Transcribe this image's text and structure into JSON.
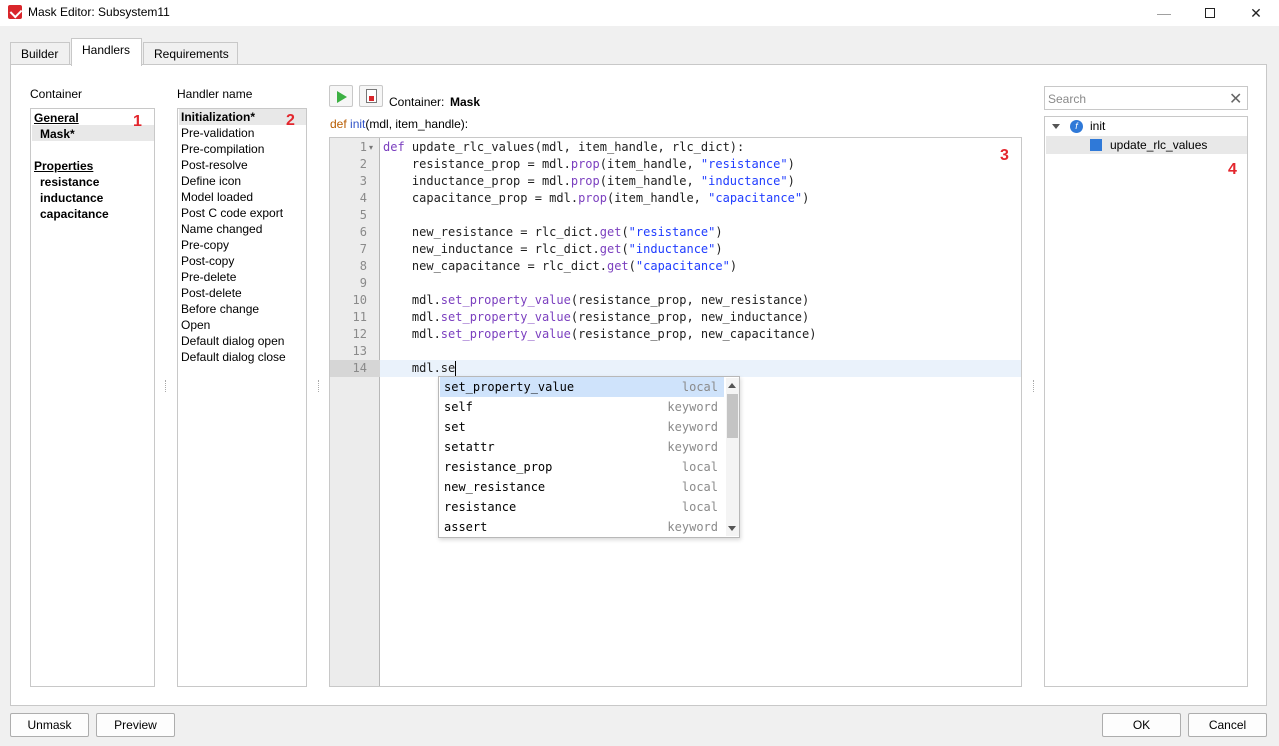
{
  "window": {
    "title": "Mask Editor: Subsystem11"
  },
  "tabs": [
    {
      "label": "Builder",
      "active": false
    },
    {
      "label": "Handlers",
      "active": true
    },
    {
      "label": "Requirements",
      "active": false
    }
  ],
  "container": {
    "label": "Container",
    "general_header": "General",
    "general_items": [
      "Mask*"
    ],
    "properties_header": "Properties",
    "properties_items": [
      "resistance",
      "inductance",
      "capacitance"
    ],
    "marker": "1"
  },
  "handlers": {
    "label": "Handler name",
    "items": [
      "Initialization*",
      "Pre-validation",
      "Pre-compilation",
      "Post-resolve",
      "Define icon",
      "Model loaded",
      "Post C code export",
      "Name changed",
      "Pre-copy",
      "Post-copy",
      "Pre-delete",
      "Post-delete",
      "Before change",
      "Open",
      "Default dialog open",
      "Default dialog close"
    ],
    "selected": "Initialization*",
    "marker": "2"
  },
  "editor": {
    "toolbar_container_label": "Container:",
    "toolbar_container_value": "Mask",
    "signature_keyword": "def",
    "signature_name": "init",
    "signature_rest": "(mdl, item_handle):",
    "marker": "3",
    "current_line": 14,
    "lines": [
      "def update_rlc_values(mdl, item_handle, rlc_dict):",
      "    resistance_prop = mdl.prop(item_handle, \"resistance\")",
      "    inductance_prop = mdl.prop(item_handle, \"inductance\")",
      "    capacitance_prop = mdl.prop(item_handle, \"capacitance\")",
      "",
      "    new_resistance = rlc_dict.get(\"resistance\")",
      "    new_inductance = rlc_dict.get(\"inductance\")",
      "    new_capacitance = rlc_dict.get(\"capacitance\")",
      "",
      "    mdl.set_property_value(resistance_prop, new_resistance)",
      "    mdl.set_property_value(resistance_prop, new_inductance)",
      "    mdl.set_property_value(resistance_prop, new_capacitance)",
      "",
      "    mdl.se"
    ],
    "autocomplete": [
      {
        "name": "set_property_value",
        "kind": "local",
        "selected": true
      },
      {
        "name": "self",
        "kind": "keyword"
      },
      {
        "name": "set",
        "kind": "keyword"
      },
      {
        "name": "setattr",
        "kind": "keyword"
      },
      {
        "name": "resistance_prop",
        "kind": "local"
      },
      {
        "name": "new_resistance",
        "kind": "local"
      },
      {
        "name": "resistance",
        "kind": "local"
      },
      {
        "name": "assert",
        "kind": "keyword"
      }
    ]
  },
  "outline": {
    "search_placeholder": "Search",
    "root": "init",
    "child": "update_rlc_values",
    "marker": "4"
  },
  "footer": {
    "unmask": "Unmask",
    "preview": "Preview",
    "ok": "OK",
    "cancel": "Cancel"
  },
  "colors": {
    "keyword": "#7b3fbf",
    "string": "#1f3cff",
    "marker": "#e3262d",
    "selection": "#cfe3fb"
  }
}
